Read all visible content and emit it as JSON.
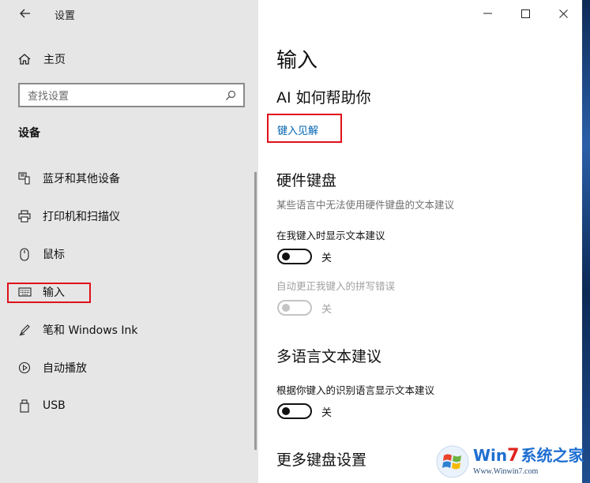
{
  "window": {
    "title": "设置"
  },
  "left": {
    "home_label": "主页",
    "search_placeholder": "查找设置",
    "section_title": "设备",
    "nav": [
      {
        "label": "蓝牙和其他设备",
        "icon": "bluetooth-devices-icon"
      },
      {
        "label": "打印机和扫描仪",
        "icon": "printer-icon"
      },
      {
        "label": "鼠标",
        "icon": "mouse-icon"
      },
      {
        "label": "输入",
        "icon": "keyboard-icon"
      },
      {
        "label": "笔和 Windows Ink",
        "icon": "pen-icon"
      },
      {
        "label": "自动播放",
        "icon": "autoplay-icon"
      },
      {
        "label": "USB",
        "icon": "usb-icon"
      }
    ],
    "selected": "输入"
  },
  "right": {
    "page_title": "输入",
    "ai_heading": "AI 如何帮助你",
    "ai_link": "键入见解",
    "hardware_heading": "硬件键盘",
    "hardware_desc": "某些语言中无法使用硬件键盘的文本建议",
    "show_suggestions_label": "在我键入时显示文本建议",
    "show_suggestions_state": "关",
    "autocorrect_label": "自动更正我键入的拼写错误",
    "autocorrect_state": "关",
    "multilang_heading": "多语言文本建议",
    "multilang_label": "根据你键入的识别语言显示文本建议",
    "multilang_state": "关",
    "more_heading": "更多键盘设置"
  },
  "watermark": {
    "brand_a": "Win",
    "brand_b": "7",
    "brand_c": "系统之家",
    "url": "Www.Winwin7.com"
  },
  "colors": {
    "accent_link": "#0063b1",
    "highlight_box": "#e0101a"
  }
}
